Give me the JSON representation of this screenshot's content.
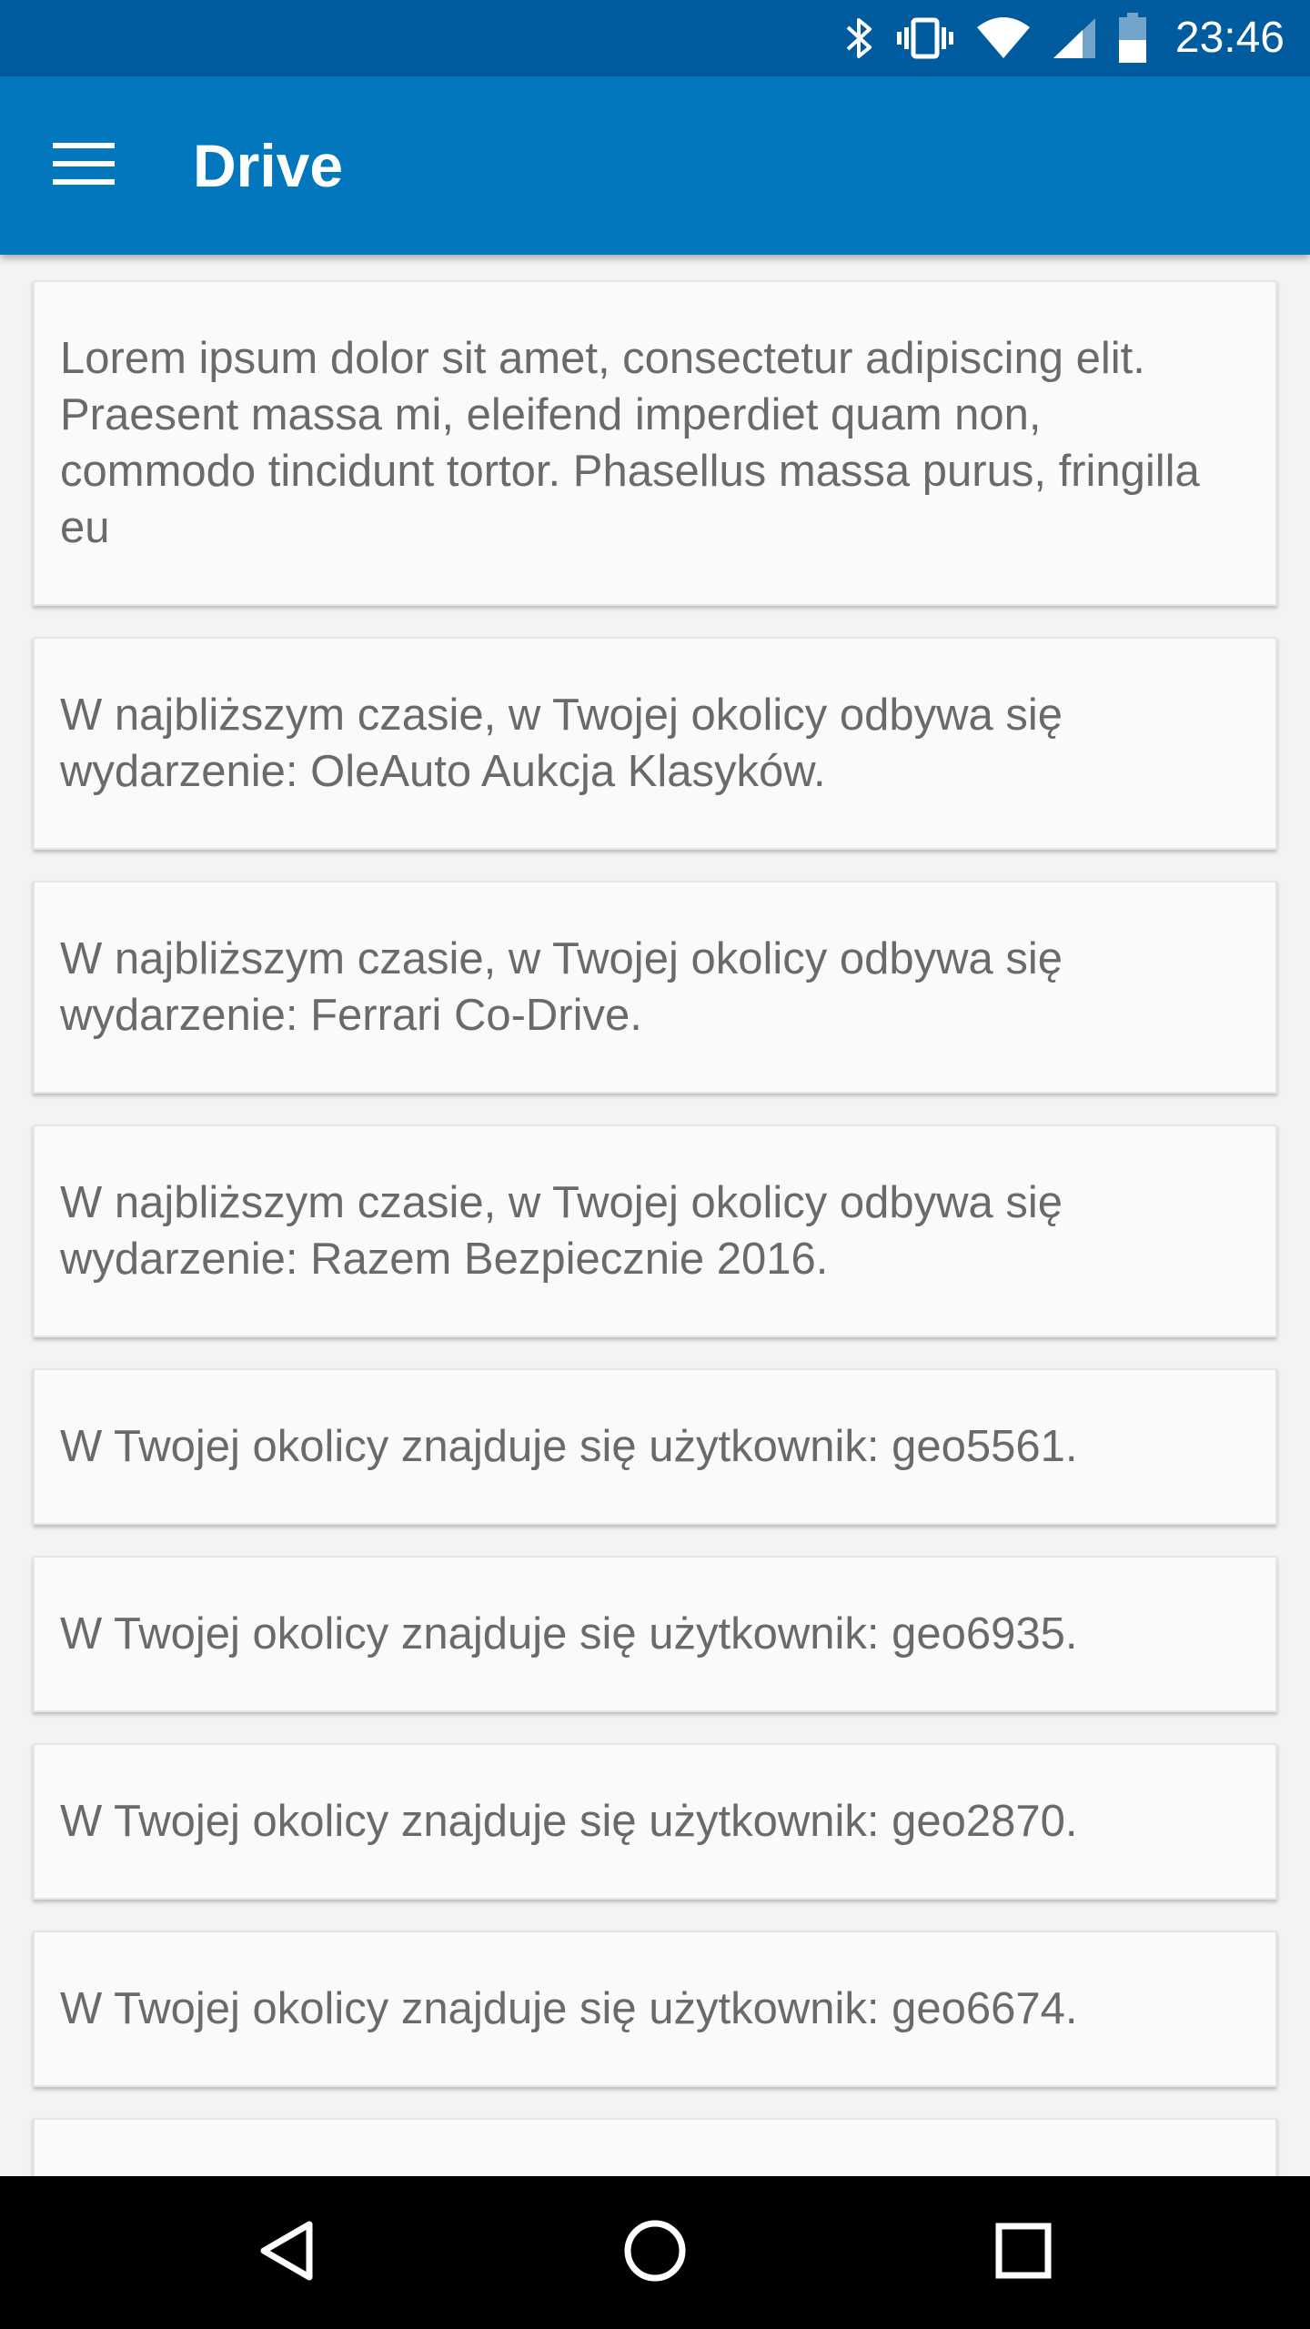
{
  "status_bar": {
    "time": "23:46",
    "icons": [
      "bluetooth-icon",
      "vibrate-icon",
      "wifi-icon",
      "cell-signal-icon",
      "battery-icon"
    ]
  },
  "app_bar": {
    "title": "Drive",
    "menu_icon": "hamburger-menu-icon"
  },
  "notifications": [
    {
      "text": "Lorem ipsum dolor sit amet, consectetur adipiscing elit. Praesent massa mi, eleifend imperdiet quam non, commodo tincidunt tortor. Phasellus massa purus, fringilla eu"
    },
    {
      "text": "W najbliższym czasie, w Twojej okolicy odbywa się wydarzenie: OleAuto Aukcja Klasyków."
    },
    {
      "text": "W najbliższym czasie, w Twojej okolicy odbywa się wydarzenie: Ferrari Co-Drive."
    },
    {
      "text": "W najbliższym czasie, w Twojej okolicy odbywa się wydarzenie: Razem Bezpiecznie 2016."
    },
    {
      "text": "W Twojej okolicy znajduje się użytkownik: geo5561."
    },
    {
      "text": "W Twojej okolicy znajduje się użytkownik: geo6935."
    },
    {
      "text": "W Twojej okolicy znajduje się użytkownik: geo2870."
    },
    {
      "text": "W Twojej okolicy znajduje się użytkownik: geo6674."
    },
    {
      "text": ""
    }
  ],
  "nav_bar": {
    "icons": [
      "back-icon",
      "home-icon",
      "recents-icon"
    ]
  },
  "colors": {
    "status_bar": "#005b9f",
    "app_bar": "#0277bd",
    "card_background": "#fafafa",
    "card_text": "#6a6a6a",
    "nav_bar": "#000000"
  }
}
